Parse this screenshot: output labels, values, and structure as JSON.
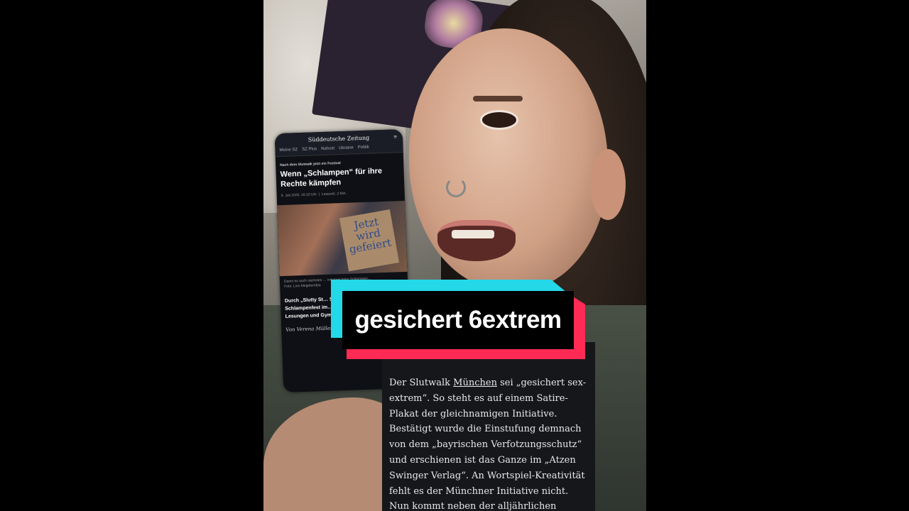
{
  "video": {
    "caption": "gesichert 6extrem"
  },
  "phone_article": {
    "masthead": "Süddeutsche Zeitung",
    "nav": [
      "Meine SZ",
      "SZ Plus",
      "Nahost",
      "Ukraine",
      "Politik"
    ],
    "kicker": "Nach dem Slutwalk jetzt ein Festival",
    "title": "Wenn „Schlampen“ für ihre Rechte kämpfen",
    "date": "9. Juli 2025, 16:10 Uhr",
    "read_time": "Lesezeit: 2 Min.",
    "sign_text": "Jetzt wird gefeiert",
    "photo_caption": "Damit es auch nächstes … initiative beim Schlampen…",
    "photo_credit": "Foto: Lino Mirgeler/dpa",
    "teaser": "Durch „Slutty St… Selbstbestimm… Schlampenfest im… sexualisierte Gewalt… Lesungen und Gymnastik.",
    "author": "Von Verena Müller-Bolzer"
  },
  "article_overlay": {
    "text_before_link": "Der Slutwalk ",
    "link": "München",
    "text_after_link": " sei „gesichert sex-extrem“. So steht es auf einem Satire-Plakat der gleichnamigen Initiative. Bestätigt wurde die Einstufung demnach von dem „bayrischen Verfotzungsschutz“ und erschienen ist das Ganze im „Atzen Swinger Verlag“. An Wortspiel-Kreativität fehlt es der Münchner Initiative nicht. Nun kommt neben der alljährlichen Demonstration"
  },
  "colors": {
    "caption_cyan": "#25d8e8",
    "caption_red": "#ff2b55",
    "caption_bg": "#000000"
  }
}
